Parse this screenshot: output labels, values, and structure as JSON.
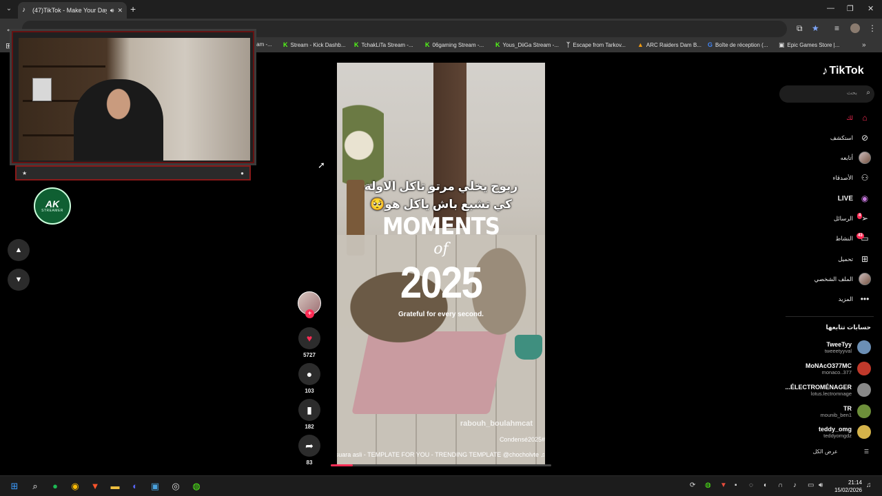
{
  "browser": {
    "tab_title": "(47)TikTok - Make Your Day",
    "bookmarks": [
      {
        "label": "ream -...",
        "icon": "kick-icon"
      },
      {
        "label": "Stream - Kick Dashb...",
        "icon": "kick-icon"
      },
      {
        "label": "TchakLiTa Stream -...",
        "icon": "kick-icon"
      },
      {
        "label": "06gaming Stream -...",
        "icon": "kick-icon"
      },
      {
        "label": "Yous_DiiGa Stream -...",
        "icon": "kick-icon"
      },
      {
        "label": "Escape from Tarkov...",
        "icon": "tarkov-icon"
      },
      {
        "label": "ARC Raiders Dam B...",
        "icon": "arc-icon"
      },
      {
        "label": "Boîte de réception (...",
        "icon": "google-icon"
      },
      {
        "label": "Epic Games Store |...",
        "icon": "epic-icon"
      }
    ]
  },
  "overlay": {
    "logo_main": "AK",
    "logo_sub": "STREAMER"
  },
  "video": {
    "caption_line1": "ربوح يخلي مرتو تاكل الاولة",
    "caption_line2": "كي تشبع باش ياكل هو🥺",
    "title_moments": "MOMENTS",
    "title_of": "of",
    "title_year": "2025",
    "subtitle": "Grateful for every second.",
    "author": "rabouh_boulahmcat",
    "hashtag": "Condensé2025#",
    "music": "suara asli - TEMPLATE FOR YOU - TRENDING TEMPLATE @chocholvte ♫",
    "progress": 0.1
  },
  "actions": {
    "likes": "5727",
    "comments": "103",
    "saves": "182",
    "shares": "83"
  },
  "sidebar": {
    "logo": "TikTok",
    "search_placeholder": "بحث",
    "nav": [
      {
        "label": "لك",
        "icon": "home-icon",
        "active": true
      },
      {
        "label": "استكشف",
        "icon": "compass-icon"
      },
      {
        "label": "أتابعه",
        "icon": "avatar-icon"
      },
      {
        "label": "الأصدقاء",
        "icon": "friends-icon"
      },
      {
        "label": "LIVE",
        "icon": "live-icon"
      },
      {
        "label": "الرسائل",
        "icon": "send-icon",
        "badge": "4"
      },
      {
        "label": "النشاط",
        "icon": "activity-icon",
        "badge": "43"
      },
      {
        "label": "تحميل",
        "icon": "upload-icon"
      },
      {
        "label": "الملف الشخصي",
        "icon": "profile-icon"
      },
      {
        "label": "المزيد",
        "icon": "more-icon"
      }
    ],
    "following_header": "حسابات تتابعها",
    "following": [
      {
        "name": "TweeTyy",
        "user": "tweeetyyval",
        "color": "#6b8fb5"
      },
      {
        "name": "MoNAcO377MC",
        "user": "monaco..377",
        "color": "#c0392b"
      },
      {
        "name": "...ÉLECTROMÉNAGER",
        "user": "lotus.lectromnage",
        "color": "#888888"
      },
      {
        "name": "TR",
        "user": "mounib_ben1",
        "color": "#6d8f3a"
      },
      {
        "name": "teddy_omg",
        "user": "teddyomgdz",
        "color": "#d4b24a"
      }
    ],
    "see_all": "عرض الكل"
  },
  "taskbar": {
    "time": "21:14",
    "date": "15/02/2026"
  },
  "colors": {
    "accent": "#fe2c55",
    "kick": "#53fc18"
  }
}
